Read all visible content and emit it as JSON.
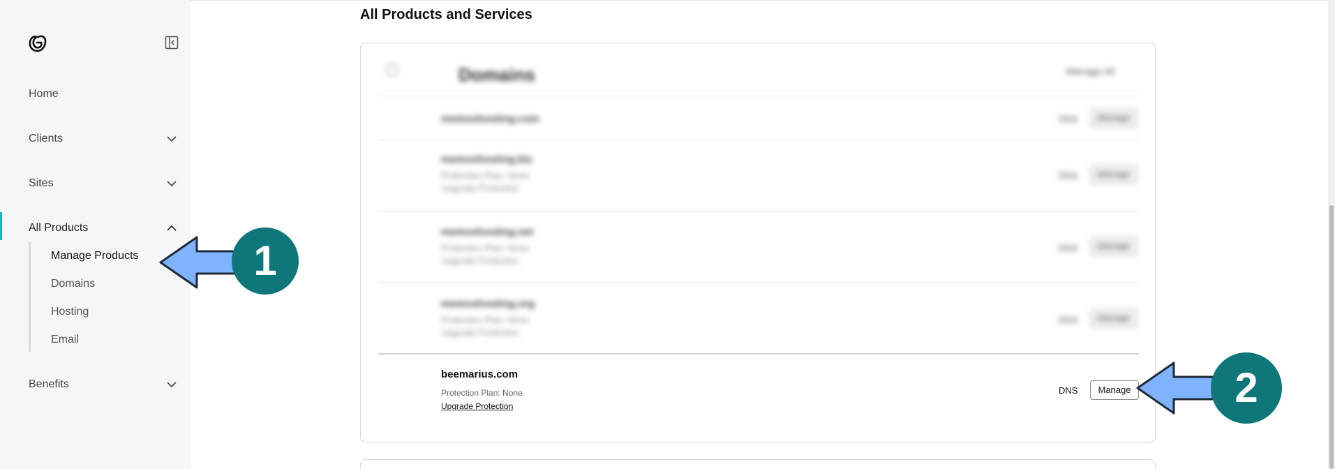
{
  "sidebar": {
    "nav": {
      "home": "Home",
      "clients": "Clients",
      "sites": "Sites",
      "all_products": "All Products",
      "benefits": "Benefits"
    },
    "sub_items": {
      "manage_products": "Manage Products",
      "domains": "Domains",
      "hosting": "Hosting",
      "email": "Email"
    },
    "icons": [
      "godaddy-logo",
      "collapse-sidebar-icon",
      "chevron-down-icon",
      "chevron-up-icon"
    ]
  },
  "main": {
    "section_title": "All Products and Services",
    "group": {
      "title": "Domains",
      "manage_all": "Manage All"
    },
    "blurred_rows": [
      {
        "domain": "memsshosting.com",
        "sub": "",
        "sub2": "",
        "dns": "DNS",
        "manage": "Manage"
      },
      {
        "domain": "memsshosting.biz",
        "sub": "Protection Plan: None",
        "sub2": "Upgrade Protection",
        "dns": "DNS",
        "manage": "Manage"
      },
      {
        "domain": "memsshosting.net",
        "sub": "Protection Plan: None",
        "sub2": "Upgrade Protection",
        "dns": "DNS",
        "manage": "Manage"
      },
      {
        "domain": "memsshosting.org",
        "sub": "Protection Plan: None",
        "sub2": "Upgrade Protection",
        "dns": "DNS",
        "manage": "Manage"
      }
    ],
    "focused_row": {
      "domain": "beemarius.com",
      "protection": "Protection Plan: None",
      "upgrade": "Upgrade Protection",
      "dns": "DNS",
      "manage": "Manage"
    }
  },
  "callouts": {
    "one": "1",
    "two": "2",
    "arrow_color": "#7fb2ff",
    "badge_color": "#0f767a"
  }
}
